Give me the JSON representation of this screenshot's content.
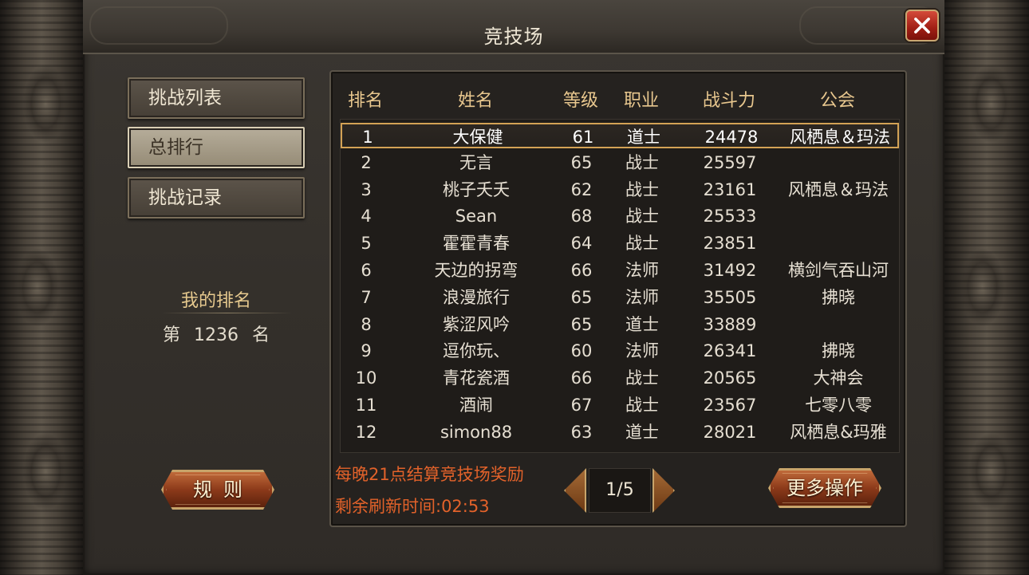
{
  "window": {
    "title": "竞技场"
  },
  "tabs": [
    {
      "label": "挑战列表"
    },
    {
      "label": "总排行"
    },
    {
      "label": "挑战记录"
    }
  ],
  "my_rank": {
    "label": "我的排名",
    "prefix": "第",
    "rank": "1236",
    "suffix": "名"
  },
  "buttons": {
    "rules": "规则",
    "more": "更多操作"
  },
  "table": {
    "headers": [
      "排名",
      "姓名",
      "等级",
      "职业",
      "战斗力",
      "公会"
    ],
    "rows": [
      [
        "1",
        "大保健",
        "61",
        "道士",
        "24478",
        "风栖息＆玛法"
      ],
      [
        "2",
        "无言",
        "65",
        "战士",
        "25597",
        ""
      ],
      [
        "3",
        "桃子夭夭",
        "62",
        "战士",
        "23161",
        "风栖息＆玛法"
      ],
      [
        "4",
        "Sean",
        "68",
        "战士",
        "25533",
        ""
      ],
      [
        "5",
        "霍霍青春",
        "64",
        "战士",
        "23851",
        ""
      ],
      [
        "6",
        "天边的拐弯",
        "66",
        "法师",
        "31492",
        "横剑气吞山河"
      ],
      [
        "7",
        "浪漫旅行",
        "65",
        "法师",
        "35505",
        "拂晓"
      ],
      [
        "8",
        "紫涩风吟",
        "65",
        "道士",
        "33889",
        ""
      ],
      [
        "9",
        "逗你玩、",
        "60",
        "法师",
        "26341",
        "拂晓"
      ],
      [
        "10",
        "青花瓷酒",
        "66",
        "战士",
        "20565",
        "大神会"
      ],
      [
        "11",
        "酒闹",
        "67",
        "战士",
        "23567",
        "七零八零"
      ],
      [
        "12",
        "simon88",
        "63",
        "道士",
        "28021",
        "风栖息&玛雅"
      ]
    ],
    "selected_row": 0
  },
  "notice": {
    "settlement": "每晚21点结算竞技场奖励",
    "refresh": "剩余刷新时间:02:53"
  },
  "pager": {
    "text": "1/5"
  },
  "colors": {
    "header": "#e8c78e",
    "notice": "#e2622a",
    "selected_border": "#d3a255"
  }
}
